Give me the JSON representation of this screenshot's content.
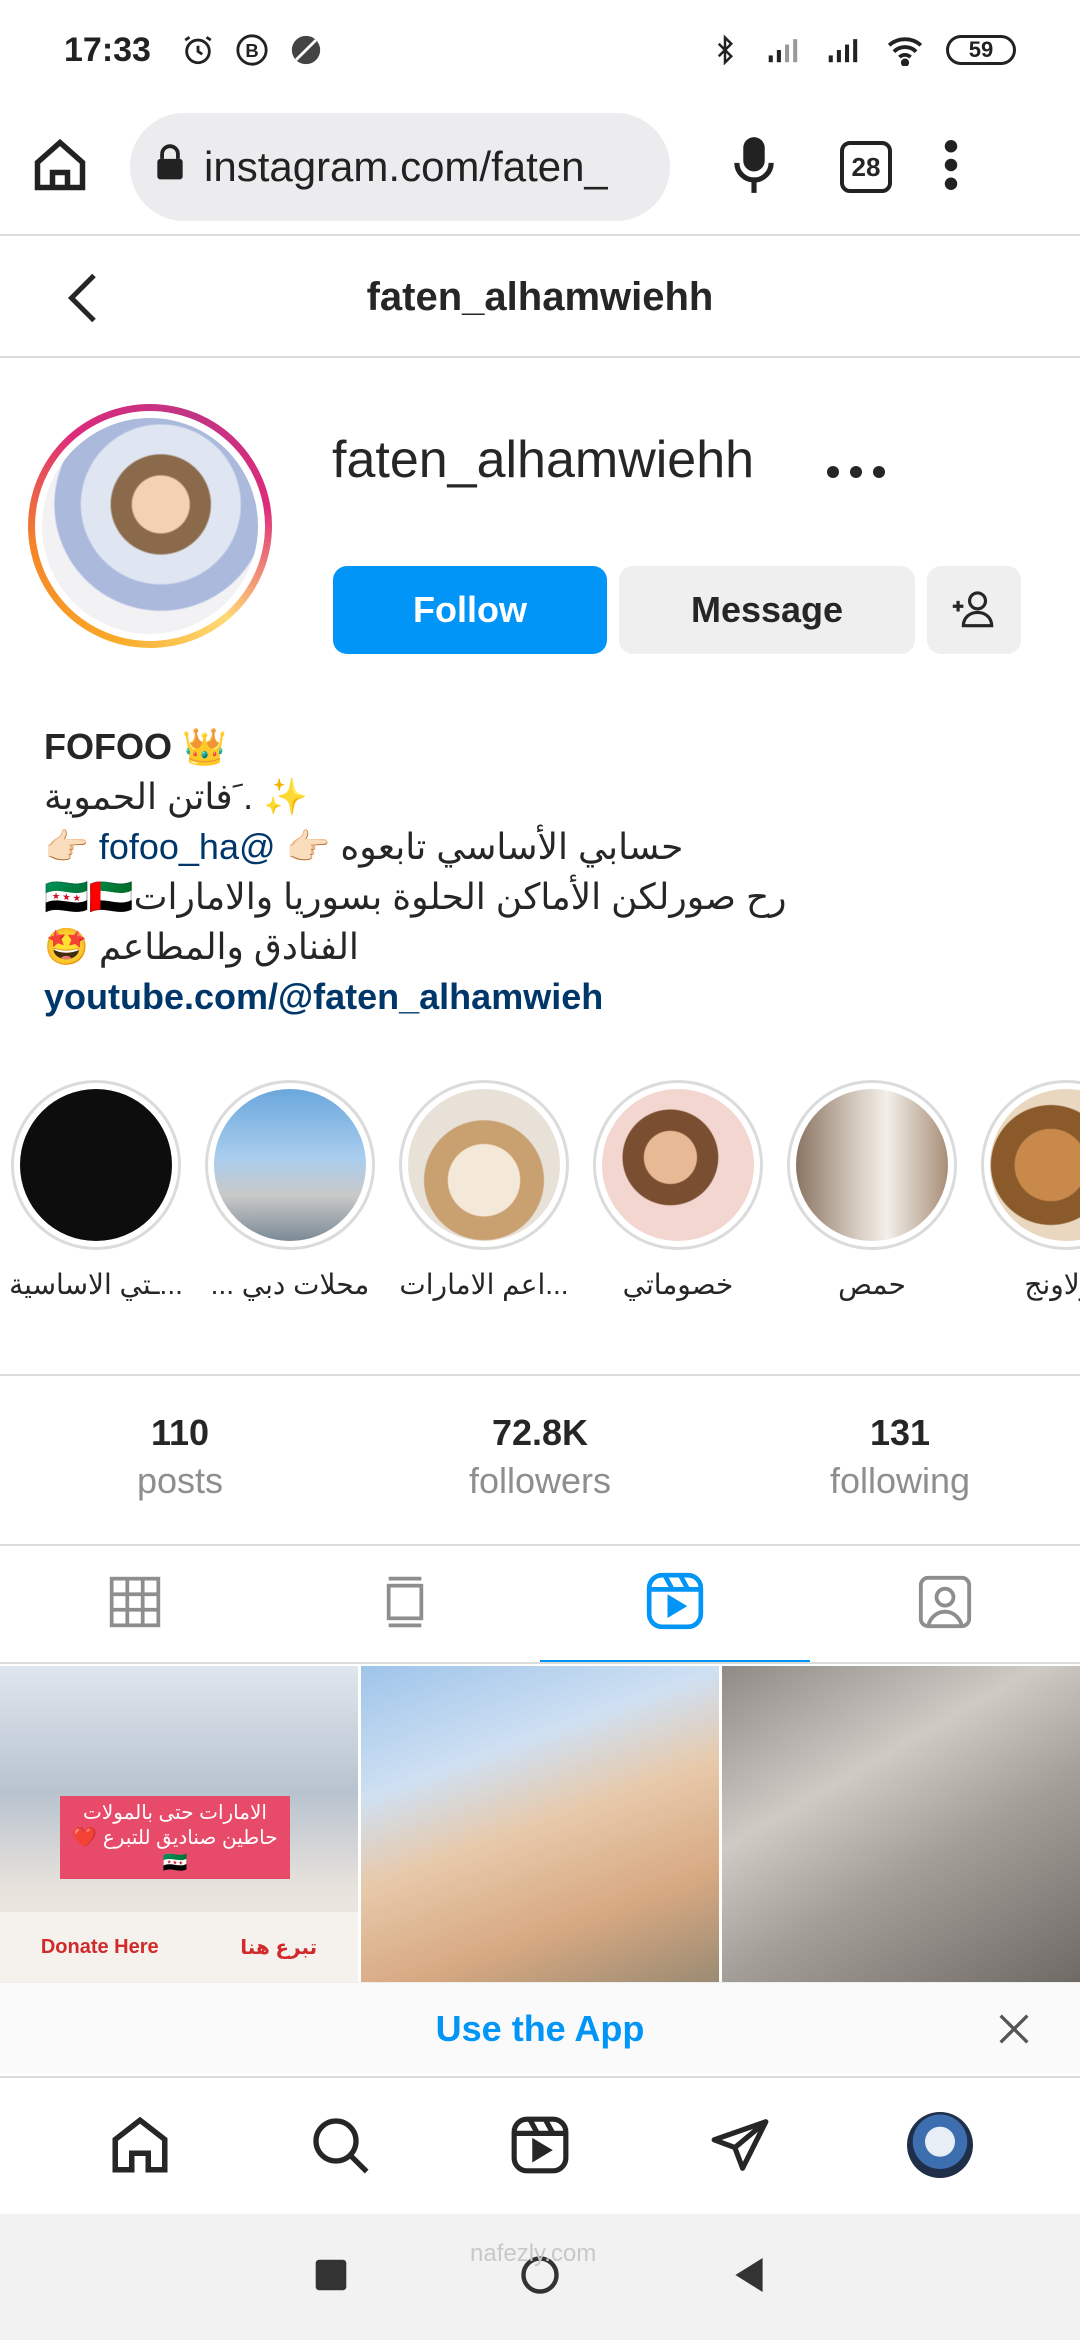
{
  "status": {
    "time": "17:33",
    "battery": "59"
  },
  "browser": {
    "url": "instagram.com/faten_",
    "tab_count": "28"
  },
  "header": {
    "title": "faten_alhamwiehh"
  },
  "profile": {
    "username": "faten_alhamwiehh",
    "follow_label": "Follow",
    "message_label": "Message"
  },
  "bio": {
    "name": "FOFOO 👑",
    "line1": "✨ .ﹶفاتن الحموية",
    "line2_text": "حسابي الأساسي تابعوه 👉🏻",
    "line2_mention": "@fofoo_ha",
    "line2_end": "👉🏻",
    "line3": "رح صورلكن الأماكن الحلوة بسوريا والامارات🇸🇾🇦🇪",
    "line4": "الفنادق والمطاعم 🤩",
    "link": "youtube.com/@faten_alhamwieh"
  },
  "highlights": [
    {
      "label": "...ـتي الاساسية"
    },
    {
      "label": "محلات دبي ..."
    },
    {
      "label": "...اعم الامارات"
    },
    {
      "label": "خصوماتي"
    },
    {
      "label": "حمص"
    },
    {
      "label": "كولاونج"
    }
  ],
  "stats": {
    "posts": {
      "value": "110",
      "label": "posts"
    },
    "followers": {
      "value": "72.8K",
      "label": "followers"
    },
    "following": {
      "value": "131",
      "label": "following"
    }
  },
  "grid": {
    "post1_overlay": "الامارات حتى بالمولات حاطين صناديق للتبرع ❤️🇸🇾",
    "post1_donate_en": "Donate Here",
    "post1_donate_ar": "تبرع هنا"
  },
  "banner": {
    "use_app_label": "Use the App"
  },
  "watermark": {
    "text": "nafezly.com"
  },
  "colors": {
    "accent": "#0095f6",
    "link": "#00376b",
    "muted": "#8e8e8e"
  }
}
